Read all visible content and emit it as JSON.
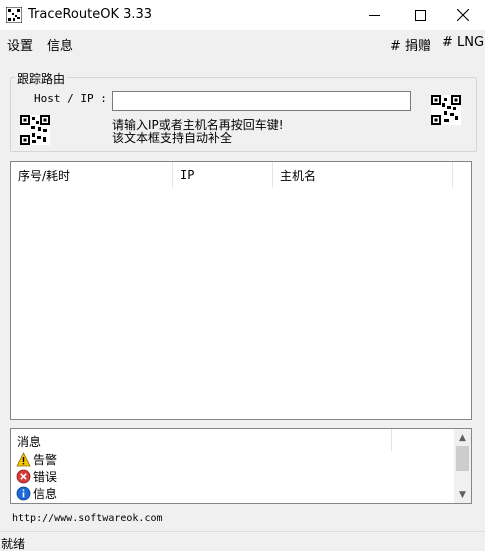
{
  "window": {
    "title": "TraceRouteOK 3.33",
    "icon": "app-qr-icon",
    "minimize_icon": "minimize-icon",
    "maximize_icon": "maximize-icon",
    "close_icon": "close-icon"
  },
  "menu": {
    "settings": "设置",
    "info": "信息",
    "donate": "# 捐赠",
    "lng": "# LNG"
  },
  "trace": {
    "group_label": "跟踪路由",
    "host_label": "Host / IP :",
    "host_value": "",
    "hint_line1": "请输入IP或者主机名再按回车键!",
    "hint_line2": "该文本框支持自动补全"
  },
  "results": {
    "columns": [
      "序号/耗时",
      "IP",
      "主机名"
    ],
    "rows": []
  },
  "messages": {
    "header": "消息",
    "items": [
      {
        "icon": "warning-icon",
        "label": "告警"
      },
      {
        "icon": "error-icon",
        "label": "错误"
      },
      {
        "icon": "info-icon",
        "label": "信息"
      }
    ]
  },
  "footer": {
    "url": "http://www.softwareok.com"
  },
  "status": {
    "text": "就绪"
  },
  "colors": {
    "background": "#f0f0f0",
    "panel": "#ffffff",
    "border": "#828790",
    "warning": "#f5c400",
    "error": "#d83b3b",
    "info": "#1c6ad8"
  }
}
